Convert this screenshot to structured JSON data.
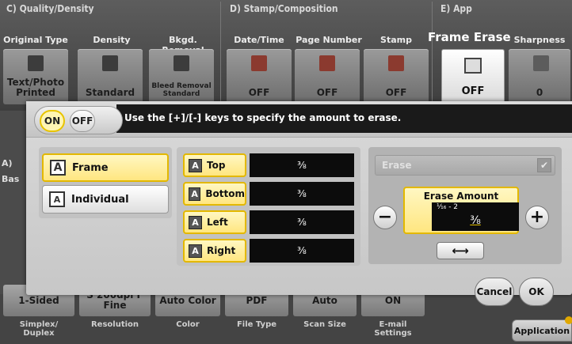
{
  "background": {
    "sections": [
      {
        "title": "C)  Quality/Density"
      },
      {
        "title": "D)  Stamp/Composition"
      },
      {
        "title": "E)  App"
      }
    ],
    "columns": [
      {
        "label": "Original Type",
        "value": "Text/Photo Printed"
      },
      {
        "label": "Density",
        "value": "Standard"
      },
      {
        "label": "Bkgd. Removal",
        "value": "Bleed Removal Standard"
      },
      {
        "label": "Date/Time",
        "value": "OFF"
      },
      {
        "label": "Page Number",
        "value": "OFF"
      },
      {
        "label": "Stamp",
        "value": "OFF"
      },
      {
        "label": "Frame Erase",
        "value": "OFF"
      },
      {
        "label": "Sharpness",
        "value": "0"
      }
    ],
    "left_stub": {
      "line1": "A)",
      "line2": "Bas"
    },
    "bottom": [
      {
        "value": "1-Sided",
        "label": "Simplex/ Duplex"
      },
      {
        "value": "S 200dpi F Fine",
        "label": "Resolution"
      },
      {
        "value": "Auto Color",
        "label": "Color"
      },
      {
        "value": "PDF",
        "label": "File Type"
      },
      {
        "value": "Auto",
        "label": "Scan Size"
      },
      {
        "value": "ON",
        "label": "E-mail Settings"
      }
    ],
    "application_label": "Application"
  },
  "dialog": {
    "on_label": "ON",
    "off_label": "OFF",
    "message": "Use the [+]/[-] keys to specify the amount to erase.",
    "mode_options": [
      {
        "label": "Frame",
        "selected": true,
        "icon": "A"
      },
      {
        "label": "Individual",
        "selected": false,
        "icon": "A"
      }
    ],
    "edges": [
      {
        "label": "Top",
        "value": "⅜"
      },
      {
        "label": "Bottom",
        "value": "⅜"
      },
      {
        "label": "Left",
        "value": "⅜"
      },
      {
        "label": "Right",
        "value": "⅜"
      }
    ],
    "erase_select": {
      "label": "Erase",
      "checked": true
    },
    "erase_amount": {
      "title": "Erase Amount",
      "range": "¹⁄₁₆ - 2",
      "value": "⅜"
    },
    "minus_label": "−",
    "plus_label": "+",
    "swap_label": "⟷",
    "cancel_label": "Cancel",
    "ok_label": "OK"
  },
  "colors": {
    "selected_fill": "#ffe680",
    "selected_border": "#e3b800",
    "screen": "#0c0c0c"
  }
}
